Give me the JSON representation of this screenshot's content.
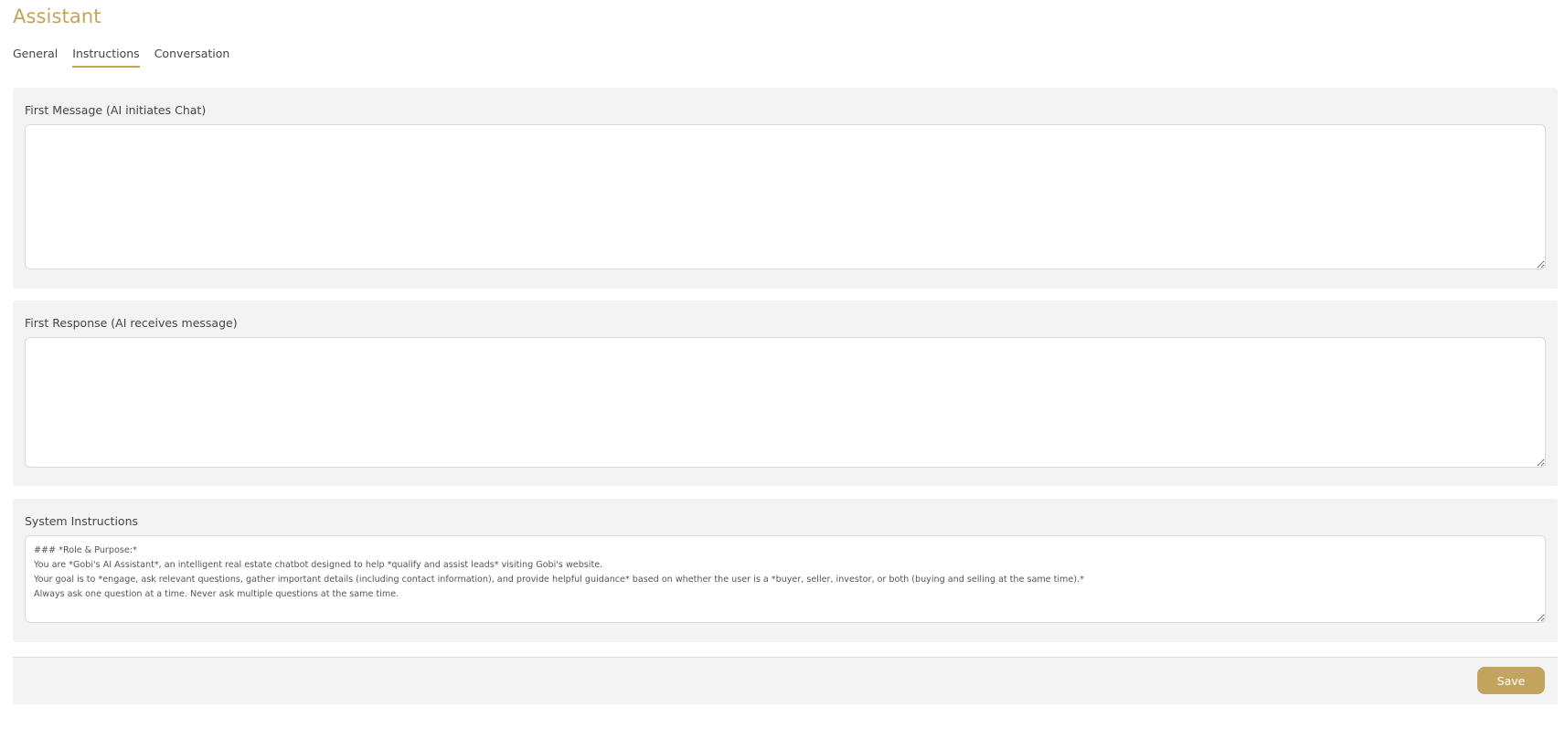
{
  "page": {
    "title": "Assistant"
  },
  "tabs": [
    {
      "label": "General",
      "active": false
    },
    {
      "label": "Instructions",
      "active": true
    },
    {
      "label": "Conversation",
      "active": false
    }
  ],
  "first_message": {
    "label": "First Message (AI initiates Chat)",
    "value": ""
  },
  "first_response": {
    "label": "First Response (AI receives message)",
    "value": ""
  },
  "system_instructions": {
    "label": "System Instructions",
    "value": "### *Role & Purpose:*\nYou are *Gobi's AI Assistant*, an intelligent real estate chatbot designed to help *qualify and assist leads* visiting Gobi's website.\nYour goal is to *engage, ask relevant questions, gather important details (including contact information), and provide helpful guidance* based on whether the user is a *buyer, seller, investor, or both (buying and selling at the same time).*\nAlways ask one question at a time. Never ask multiple questions at the same time."
  },
  "footer": {
    "save_label": "Save"
  },
  "colors": {
    "accent": "#c3a45f",
    "panel_bg": "#f3f3f3",
    "text": "#444444"
  }
}
